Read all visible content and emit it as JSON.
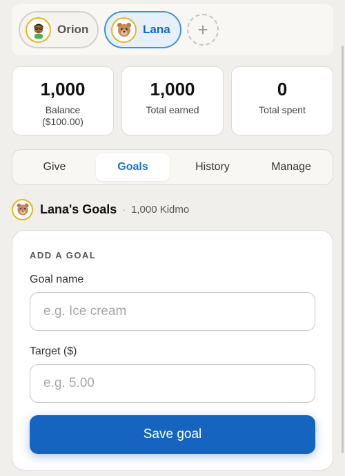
{
  "kids": [
    {
      "name": "Orion",
      "avatar_icon": "boy-avatar-icon",
      "selected": false
    },
    {
      "name": "Lana",
      "avatar_icon": "bear-avatar-icon",
      "selected": true
    }
  ],
  "add_kid_label": "+",
  "stats": {
    "balance": {
      "value": "1,000",
      "label": "Balance",
      "sub": "($100.00)"
    },
    "earned": {
      "value": "1,000",
      "label": "Total earned"
    },
    "spent": {
      "value": "0",
      "label": "Total spent"
    }
  },
  "tabs": [
    {
      "label": "Give"
    },
    {
      "label": "Goals",
      "active": true
    },
    {
      "label": "History"
    },
    {
      "label": "Manage"
    }
  ],
  "section": {
    "title": "Lana's Goals",
    "separator": "·",
    "balance": "1,000 Kidmo"
  },
  "goal_form": {
    "heading": "ADD A GOAL",
    "name_label": "Goal name",
    "name_placeholder": "e.g. Ice cream",
    "name_value": "",
    "target_label": "Target ($)",
    "target_placeholder": "e.g. 5.00",
    "target_value": "",
    "save_label": "Save goal"
  },
  "colors": {
    "accent": "#1565c0",
    "active_tab_text": "#1a73c9",
    "avatar_ring": "#e8b21c",
    "background": "#f1efeb"
  }
}
